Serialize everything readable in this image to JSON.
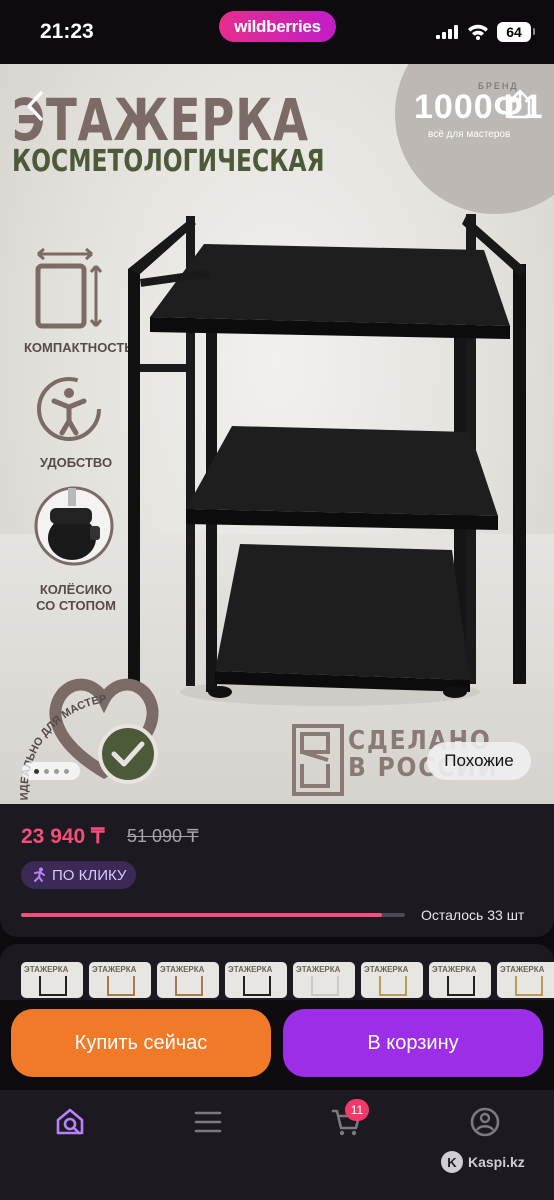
{
  "status_bar": {
    "time": "21:23",
    "app_pill": "wildberries",
    "battery": "64"
  },
  "hero": {
    "title": "ЭТАЖЕРКА",
    "subtitle": "КОСМЕТОЛОГИЧЕСКАЯ",
    "brand_label": "БРЕНД",
    "brand_logo": "1000Ф1",
    "brand_tagline": "всё для мастеров",
    "features": [
      {
        "label": "КОМПАКТНОСТЬ",
        "icon": "compact-icon"
      },
      {
        "label": "УДОБСТВО",
        "icon": "comfort-icon"
      },
      {
        "label_line1": "КОЛЁСИКО",
        "label_line2": "СО СТОПОМ",
        "icon": "wheel-icon"
      }
    ],
    "curved_caption": "ИДЕАЛЬНО ДЛЯ МАСТЕРОВ",
    "made_in_line1": "СДЕЛАНО",
    "made_in_line2": "В РОССИИ",
    "similar_button": "Похожие",
    "carousel": {
      "slides": 4,
      "active": 1
    }
  },
  "price": {
    "current": "23 940 ₸",
    "old": "51 090 ₸",
    "promo": "ПО КЛИКУ",
    "stock_text": "Осталось 33 шт",
    "stock_fraction": 0.94
  },
  "thumbnails": [
    {
      "title": "ЭТАЖЕРКА",
      "variant": "black"
    },
    {
      "title": "ЭТАЖЕРКА",
      "variant": "wood"
    },
    {
      "title": "ЭТАЖЕРКА",
      "variant": "wood"
    },
    {
      "title": "ЭТАЖЕРКА",
      "variant": "black"
    },
    {
      "title": "ЭТАЖЕРКА",
      "variant": "white"
    },
    {
      "title": "ЭТАЖЕРКА",
      "variant": "gold"
    },
    {
      "title": "ЭТАЖЕРКА",
      "variant": "black"
    },
    {
      "title": "ЭТАЖЕРКА",
      "variant": "gold"
    }
  ],
  "actions": {
    "buy_now": "Купить сейчас",
    "add_to_cart": "В корзину"
  },
  "nav": {
    "items": [
      "home-search-icon",
      "menu-icon",
      "cart-icon",
      "profile-icon"
    ],
    "cart_count": "11",
    "watermark": "Kaspi.kz"
  },
  "colors": {
    "price": "#f24f7a",
    "buy": "#f07a28",
    "cart": "#9b2ee6",
    "wb_pill": "#cb22b8"
  }
}
